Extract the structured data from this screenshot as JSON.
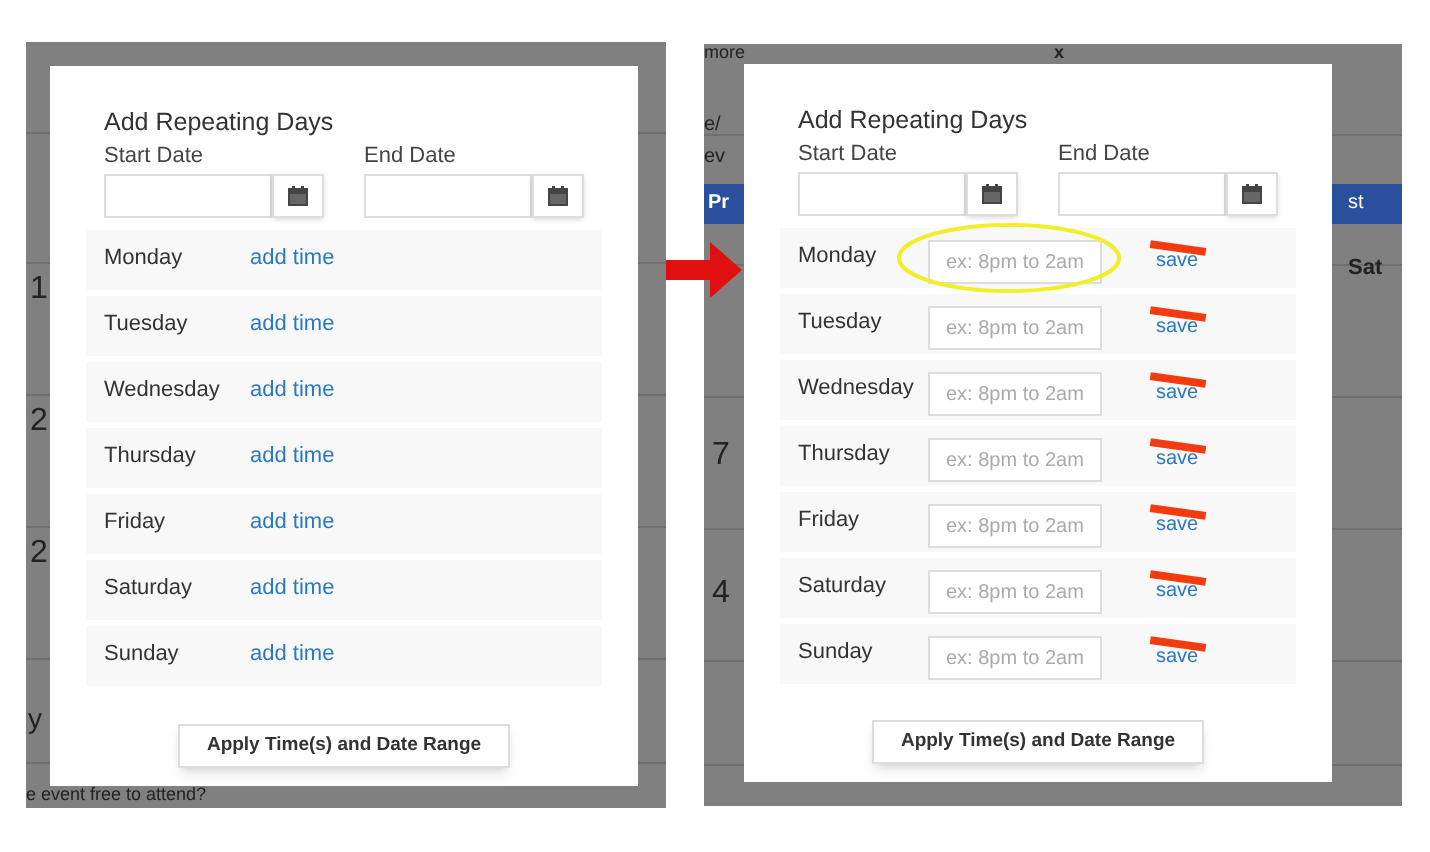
{
  "panels": [
    {
      "backdrop_texts": [
        "1",
        "2",
        "2",
        "y",
        "e event free to attend?"
      ],
      "dialog": {
        "title": "Add Repeating Days",
        "start_label": "Start Date",
        "end_label": "End Date",
        "button": "Apply Time(s) and Date Range",
        "days": [
          {
            "kind": "link",
            "name": "Monday",
            "link": "add time"
          },
          {
            "kind": "link",
            "name": "Tuesday",
            "link": "add time"
          },
          {
            "kind": "link",
            "name": "Wednesday",
            "link": "add time"
          },
          {
            "kind": "link",
            "name": "Thursday",
            "link": "add time"
          },
          {
            "kind": "link",
            "name": "Friday",
            "link": "add time"
          },
          {
            "kind": "link",
            "name": "Saturday",
            "link": "add time"
          },
          {
            "kind": "link",
            "name": "Sunday",
            "link": "add time"
          }
        ]
      }
    },
    {
      "backdrop_texts": [
        "more",
        "x",
        "e/",
        "ev",
        "Pr",
        "st",
        "Sat",
        "7",
        "4"
      ],
      "dialog": {
        "title": "Add Repeating Days",
        "start_label": "Start Date",
        "end_label": "End Date",
        "button": "Apply Time(s) and Date Range",
        "days": [
          {
            "kind": "input",
            "name": "Monday",
            "placeholder": "ex: 8pm to 2am",
            "link": "save",
            "struck": true,
            "highlighted": true
          },
          {
            "kind": "input",
            "name": "Tuesday",
            "placeholder": "ex: 8pm to 2am",
            "link": "save",
            "struck": true,
            "highlighted": false
          },
          {
            "kind": "input",
            "name": "Wednesday",
            "placeholder": "ex: 8pm to 2am",
            "link": "save",
            "struck": true,
            "highlighted": false
          },
          {
            "kind": "input",
            "name": "Thursday",
            "placeholder": "ex: 8pm to 2am",
            "link": "save",
            "struck": true,
            "highlighted": false
          },
          {
            "kind": "input",
            "name": "Friday",
            "placeholder": "ex: 8pm to 2am",
            "link": "save",
            "struck": true,
            "highlighted": false
          },
          {
            "kind": "input",
            "name": "Saturday",
            "placeholder": "ex: 8pm to 2am",
            "link": "save",
            "struck": true,
            "highlighted": false
          },
          {
            "kind": "input",
            "name": "Sunday",
            "placeholder": "ex: 8pm to 2am",
            "link": "save",
            "struck": true,
            "highlighted": false
          }
        ]
      }
    }
  ]
}
